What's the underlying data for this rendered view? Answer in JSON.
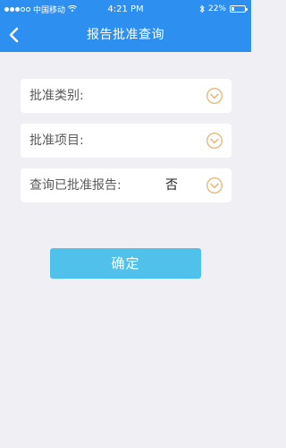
{
  "status_bar": {
    "carrier": "中国移动",
    "time": "4:21 PM",
    "battery_text": "22%",
    "battery_level": 0.22,
    "signal_bars": 3
  },
  "header": {
    "title": "报告批准查询"
  },
  "form": {
    "fields": [
      {
        "label": "批准类别:",
        "value": ""
      },
      {
        "label": "批准项目:",
        "value": ""
      },
      {
        "label": "查询已批准报告:",
        "value": "否"
      }
    ]
  },
  "actions": {
    "confirm_label": "确定"
  },
  "colors": {
    "nav_bar": "#2d8ff0",
    "background": "#efeff4",
    "button": "#4fc1ea",
    "dropdown_icon": "#e8b879"
  },
  "icons": {
    "back": "chevron-left-icon",
    "dropdown": "chevron-down-circle-icon"
  }
}
